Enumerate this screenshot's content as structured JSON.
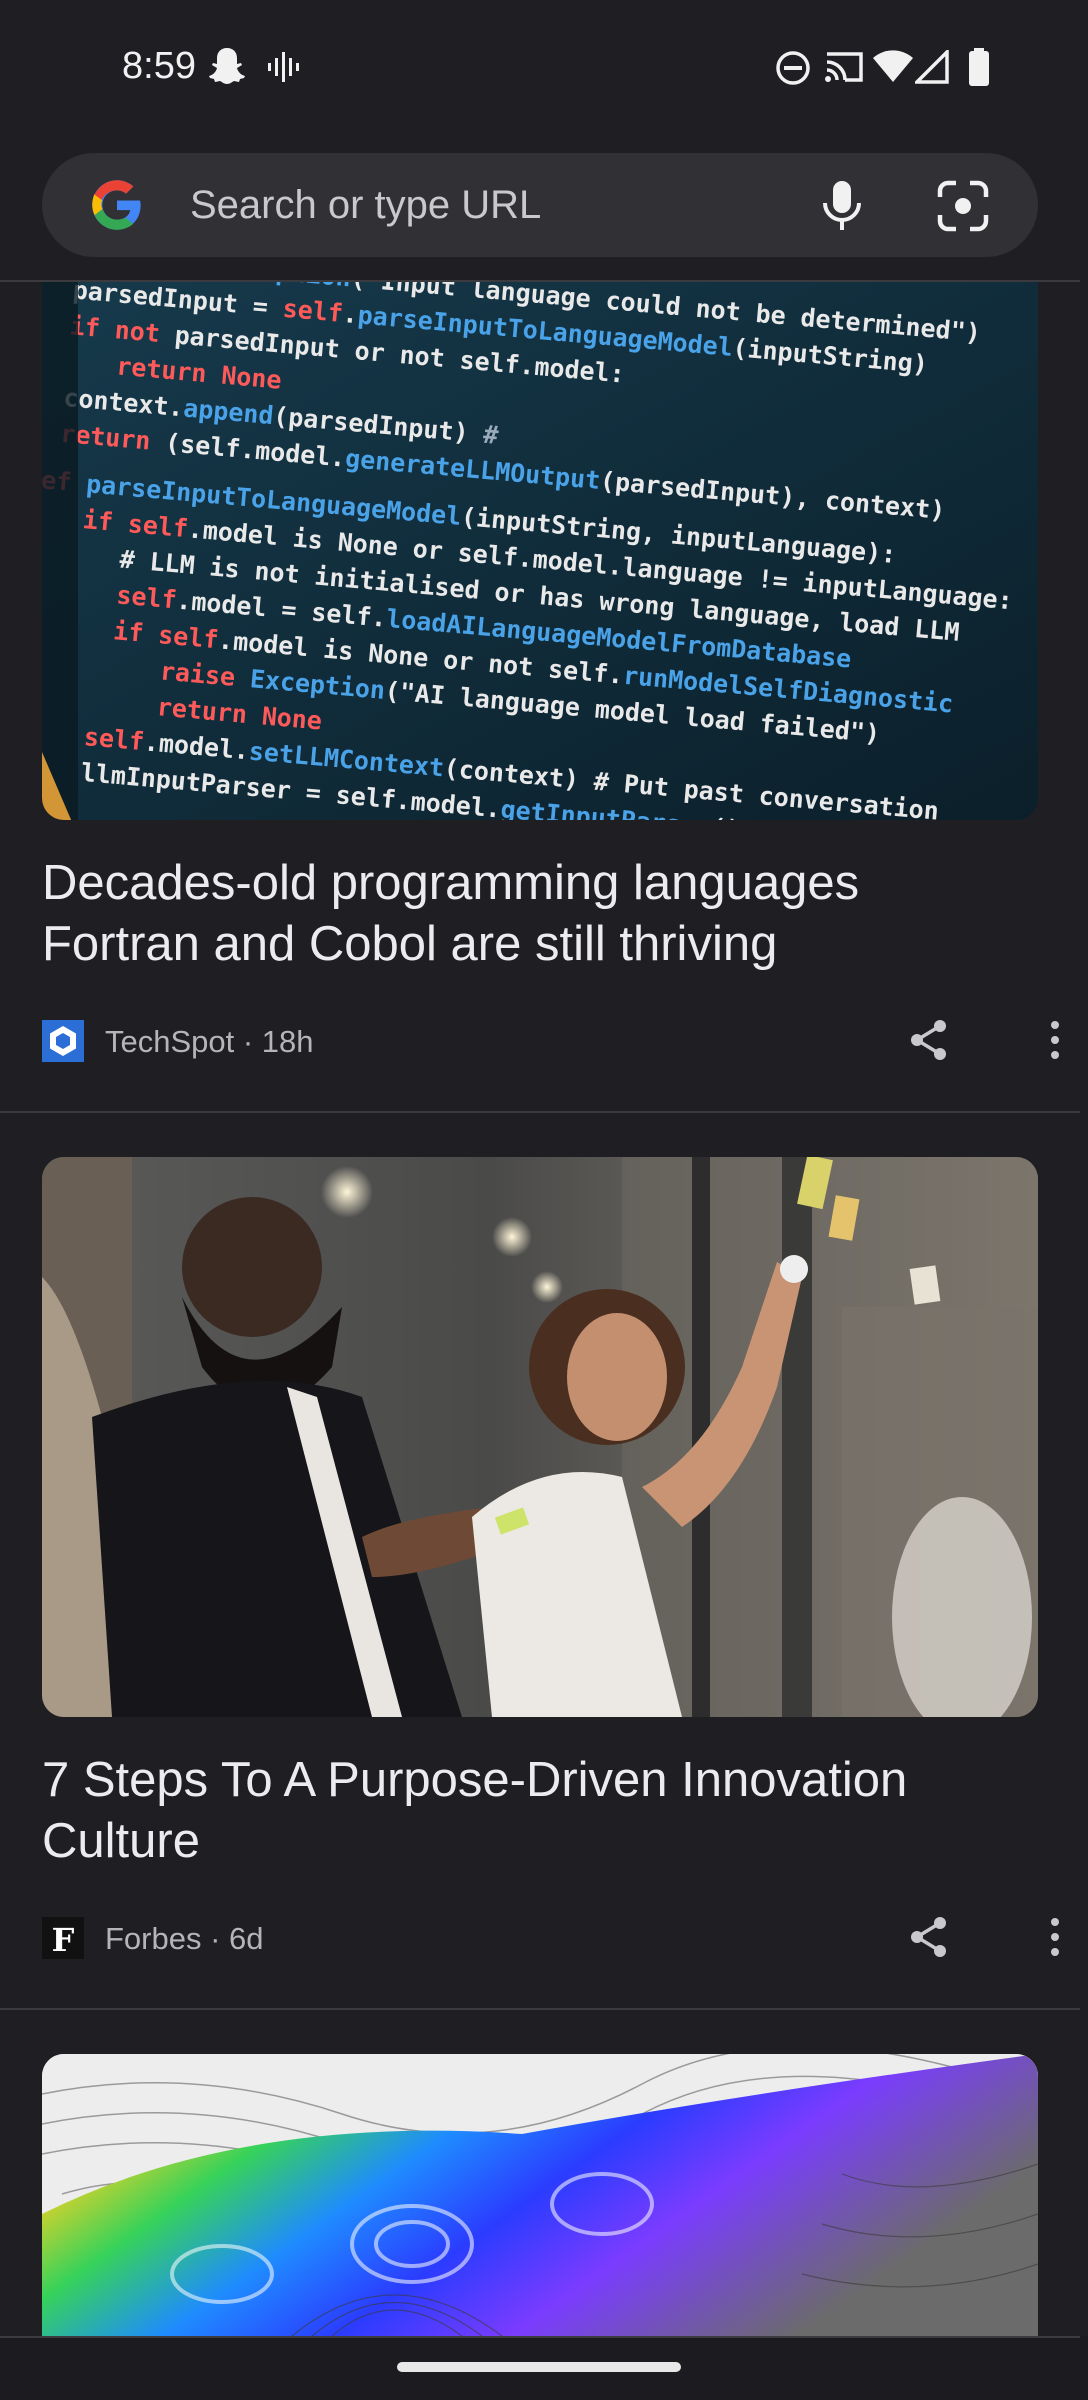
{
  "status_bar": {
    "time": "8:59",
    "left_icons": [
      "snapchat-icon",
      "voicemail-icon"
    ],
    "right_icons": [
      "do-not-disturb-icon",
      "cast-icon",
      "wifi-icon",
      "signal-icon",
      "battery-icon"
    ]
  },
  "search": {
    "placeholder": "Search or type URL",
    "icons": [
      "google-logo",
      "mic-icon",
      "lens-icon"
    ]
  },
  "feed": {
    "articles": [
      {
        "headline": "Decades-old programming languages Fortran and Cobol are still thriving",
        "source": "TechSpot",
        "age": "18h",
        "meta": "TechSpot · 18h",
        "image": "code-screen-image"
      },
      {
        "headline": "7 Steps To A Purpose-Driven Innovation Culture",
        "source": "Forbes",
        "age": "6d",
        "meta": "Forbes · 6d",
        "image": "office-sticky-notes-image"
      },
      {
        "image": "interferogram-map-image"
      }
    ]
  },
  "colors": {
    "background": "#1f1f23",
    "search_bar": "#303035",
    "headline": "#ececee",
    "meta": "#b4b4b9"
  }
}
